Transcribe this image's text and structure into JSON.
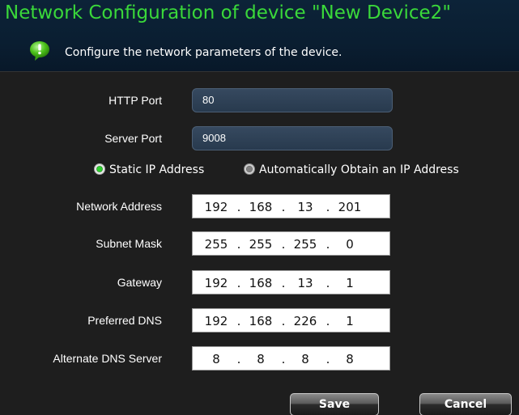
{
  "dialog": {
    "title": "Network Configuration of device \"New Device2\"",
    "subtitle": "Configure the network parameters of the device.",
    "hint_icon": "speech-bubble-info-icon",
    "accent_color": "#3ad83a"
  },
  "ports": {
    "http_label": "HTTP Port",
    "http_value": "80",
    "server_label": "Server Port",
    "server_value": "9008"
  },
  "ip_mode": {
    "static_label": "Static IP Address",
    "auto_label": "Automatically Obtain an IP Address",
    "selected": "static"
  },
  "network": {
    "address": {
      "label": "Network Address",
      "octets": [
        "192",
        "168",
        "13",
        "201"
      ]
    },
    "subnet": {
      "label": "Subnet Mask",
      "octets": [
        "255",
        "255",
        "255",
        "0"
      ]
    },
    "gateway": {
      "label": "Gateway",
      "octets": [
        "192",
        "168",
        "13",
        "1"
      ]
    },
    "dns1": {
      "label": "Preferred DNS",
      "octets": [
        "192",
        "168",
        "226",
        "1"
      ]
    },
    "dns2": {
      "label": "Alternate DNS Server",
      "octets": [
        "8",
        "8",
        "8",
        "8"
      ]
    }
  },
  "separator": ".",
  "buttons": {
    "save": "Save",
    "cancel": "Cancel"
  }
}
